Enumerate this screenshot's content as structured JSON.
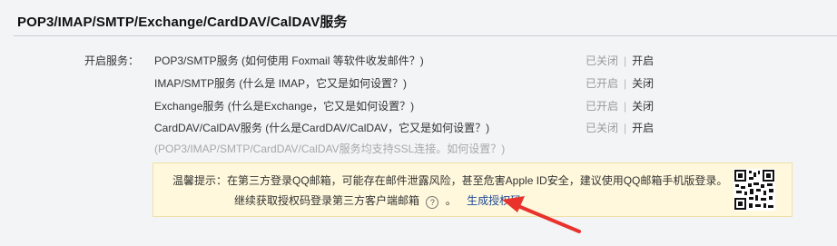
{
  "header": {
    "title": "POP3/IMAP/SMTP/Exchange/CardDAV/CalDAV服务"
  },
  "services_label": "开启服务：",
  "services": [
    {
      "name": "POP3/SMTP服务",
      "help": "(如何使用 Foxmail 等软件收发邮件？)",
      "status": "已关闭",
      "action": "开启"
    },
    {
      "name": "IMAP/SMTP服务",
      "help": "(什么是 IMAP，它又是如何设置？)",
      "status": "已开启",
      "action": "关闭"
    },
    {
      "name": "Exchange服务",
      "help": "(什么是Exchange，它又是如何设置？)",
      "status": "已开启",
      "action": "关闭"
    },
    {
      "name": "CardDAV/CalDAV服务",
      "help": "(什么是CardDAV/CalDAV，它又是如何设置？)",
      "status": "已关闭",
      "action": "开启"
    }
  ],
  "ssl_note": "(POP3/IMAP/SMTP/CardDAV/CalDAV服务均支持SSL连接。如何设置？)",
  "tip": {
    "line1": "温馨提示：在第三方登录QQ邮箱，可能存在邮件泄露风险，甚至危害Apple ID安全，建议使用QQ邮箱手机版登录。",
    "line2": "继续获取授权码登录第三方客户端邮箱",
    "question_mark": "?",
    "period": "。",
    "generate_link": "生成授权码"
  },
  "colors": {
    "link": "#1e4a96",
    "tip_bg": "#fff8dc",
    "arrow": "#e8322b"
  }
}
